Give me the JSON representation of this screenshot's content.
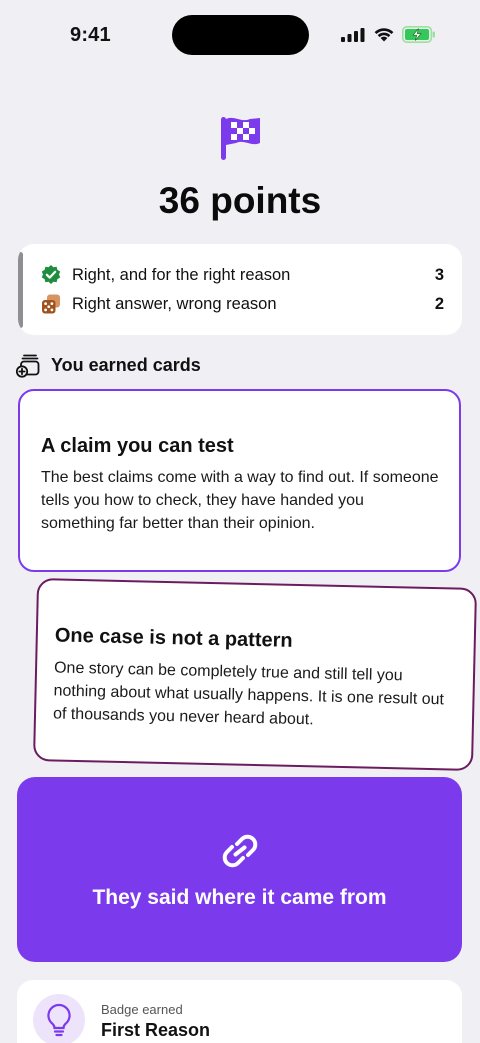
{
  "status": {
    "time": "9:41"
  },
  "summary": {
    "points": "36 points"
  },
  "score": [
    {
      "icon": "check-seal-icon",
      "label": "Right, and for the right reason",
      "count": "3"
    },
    {
      "icon": "dice-icon",
      "label": "Right answer, wrong reason",
      "count": "2"
    }
  ],
  "cards_section": {
    "title": "You earned cards"
  },
  "cards": [
    {
      "title": "A claim you can test",
      "body": "The best claims come with a way to find out. If someone tells you how to check, they have handed you something far better than their opinion."
    },
    {
      "title": "One case is not a pattern",
      "body": "One story can be completely true and still tell you nothing about what usually happens. It is one result out of thousands you never heard about."
    }
  ],
  "highlight": {
    "icon": "link-icon",
    "text": "They said where it came from"
  },
  "badge": {
    "icon": "lightbulb-icon",
    "subtitle": "Badge earned",
    "title": "First Reason"
  },
  "colors": {
    "accent": "#7c3aed",
    "background": "#f0eff4",
    "green": "#1e8e3e",
    "brown": "#a0521e",
    "card2_border": "#6b1c5f"
  }
}
